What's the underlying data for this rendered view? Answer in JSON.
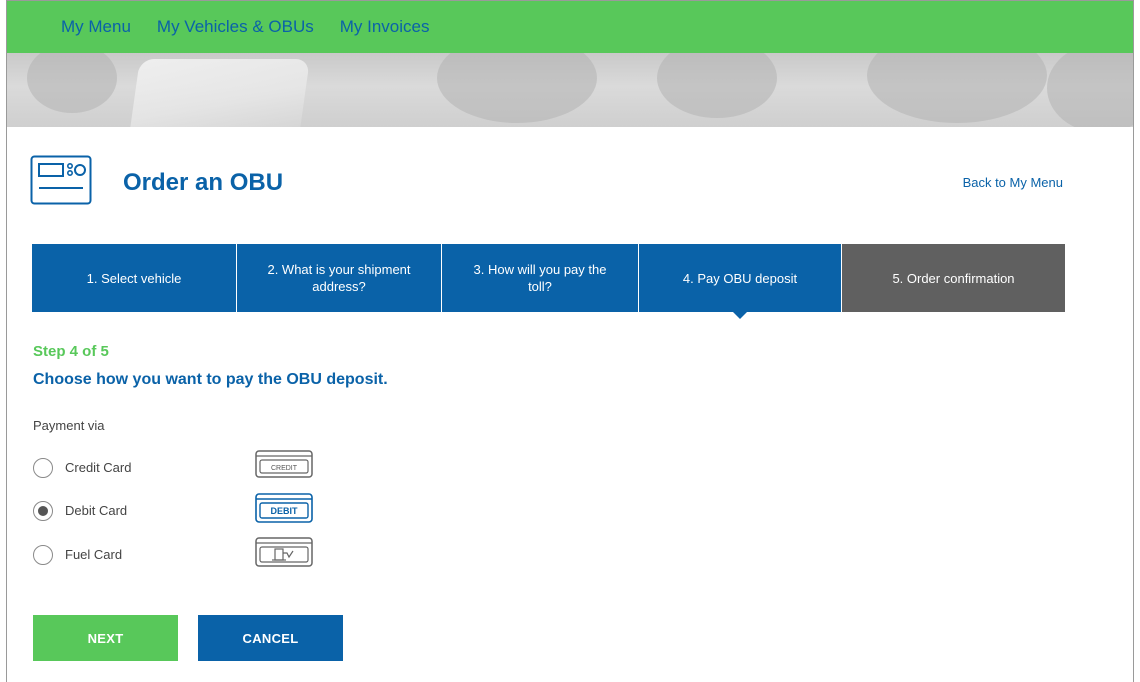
{
  "nav": {
    "items": [
      "My Menu",
      "My Vehicles & OBUs",
      "My Invoices"
    ]
  },
  "page": {
    "title": "Order an OBU",
    "back_link": "Back to My Menu"
  },
  "steps": [
    {
      "label": "1. Select vehicle",
      "state": "done"
    },
    {
      "label": "2. What is your shipment address?",
      "state": "done"
    },
    {
      "label": "3. How will you pay the toll?",
      "state": "done"
    },
    {
      "label": "4. Pay OBU deposit",
      "state": "current"
    },
    {
      "label": "5. Order confirmation",
      "state": "todo"
    }
  ],
  "form": {
    "step_count": "Step 4 of 5",
    "question": "Choose how you want to pay the OBU deposit.",
    "payment_label": "Payment via",
    "options": [
      {
        "label": "Credit Card",
        "selected": false,
        "icon": "credit-card-icon",
        "icon_text": "CREDIT"
      },
      {
        "label": "Debit Card",
        "selected": true,
        "icon": "debit-card-icon",
        "icon_text": "DEBIT"
      },
      {
        "label": "Fuel Card",
        "selected": false,
        "icon": "fuel-card-icon"
      }
    ]
  },
  "buttons": {
    "next": "NEXT",
    "cancel": "CANCEL"
  },
  "colors": {
    "green": "#58c85a",
    "blue": "#0a62a8",
    "grey_step": "#606060"
  }
}
